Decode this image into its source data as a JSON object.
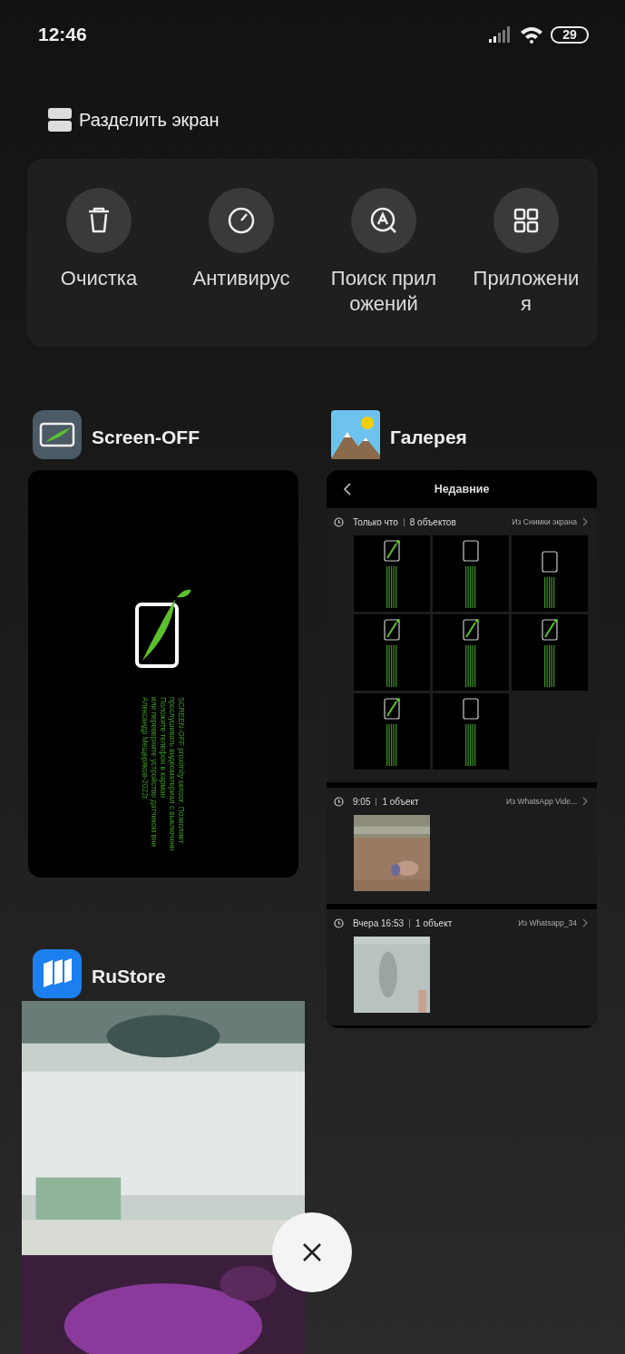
{
  "status_bar": {
    "time": "12:46",
    "battery": "29"
  },
  "split_screen": {
    "label": "Разделить экран"
  },
  "tools": [
    {
      "label": "Очистка"
    },
    {
      "label": "Антивирус"
    },
    {
      "label": "Поиск приложений"
    },
    {
      "label": "Приложения"
    }
  ],
  "left_column": [
    {
      "name": "Screen-OFF",
      "kind": "screen_off",
      "preview_lines": [
        "SCREEN-OFF  proximity sensor. Позволяет",
        "прослушивать видеоматериал с выключенн",
        "Положите телефон в карман",
        "или переверните устройство датчиком вни",
        "Александр Мещеряков-2022г."
      ]
    },
    {
      "name": "RuStore",
      "kind": "picture"
    }
  ],
  "right_column": [
    {
      "name": "Галерея",
      "kind": "gallery",
      "title": "Недавние",
      "sections": [
        {
          "time": "Только что",
          "count": "8 объектов",
          "source": "Из Снимки экрана",
          "thumbs": [
            {
              "kind": "screen",
              "leaf": true
            },
            {
              "kind": "screen",
              "leaf": false
            },
            {
              "kind": "screen",
              "leaf": false
            },
            {
              "kind": "screen",
              "leaf": true
            },
            {
              "kind": "screen",
              "leaf": true
            },
            {
              "kind": "screen",
              "leaf": true
            },
            {
              "kind": "screen",
              "leaf": true
            },
            {
              "kind": "screen",
              "leaf": false
            }
          ]
        },
        {
          "time": "9:05",
          "count": "1 объект",
          "source": "Из WhatsApp Vide..."
        },
        {
          "time": "Вчера 16:53",
          "count": "1 объект",
          "source": "Из Whatsapp_34"
        }
      ]
    }
  ]
}
